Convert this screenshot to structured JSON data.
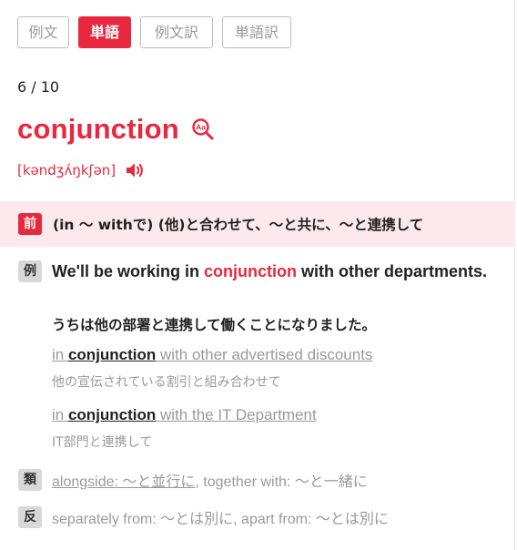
{
  "tabs": [
    {
      "label": "例文",
      "active": false
    },
    {
      "label": "単語",
      "active": true
    },
    {
      "label": "例文訳",
      "active": false
    },
    {
      "label": "単語訳",
      "active": false
    }
  ],
  "counter": "6 / 10",
  "entry": {
    "headword": "conjunction",
    "pronunciation": "[kəndʒʌ́ŋkʃən]",
    "lookup_icon": "dictionary-lookup-icon",
    "speaker_icon": "speaker-icon"
  },
  "definition": {
    "pos_badge": "前",
    "text": "(in ～ withで) (他)と合わせて、～と共に、～と連携して"
  },
  "example": {
    "badge": "例",
    "sentence_before": "We'll be working in ",
    "sentence_highlight": "conjunction",
    "sentence_after": " with other departments.",
    "translation": "うちは他の部署と連携して働くことになりました。"
  },
  "collocations": [
    {
      "prefix": "in ",
      "keyword": "conjunction",
      "suffix": " with other advertised discounts",
      "translation": "他の宣伝されている割引と組み合わせて"
    },
    {
      "prefix": "in ",
      "keyword": "conjunction",
      "suffix": " with the IT Department",
      "translation": "IT部門と連携して"
    }
  ],
  "synonyms": {
    "badge": "類",
    "link_text": "alongside: ～と並行に",
    "rest_text": ", together with: ～と一緒に"
  },
  "antonyms": {
    "badge": "反",
    "text": "separately from: ～とは別に, apart from: ～とは別に"
  },
  "colors": {
    "accent": "#e8283f",
    "definition_background": "#fde9ec",
    "muted_text": "#9a9a9a"
  }
}
